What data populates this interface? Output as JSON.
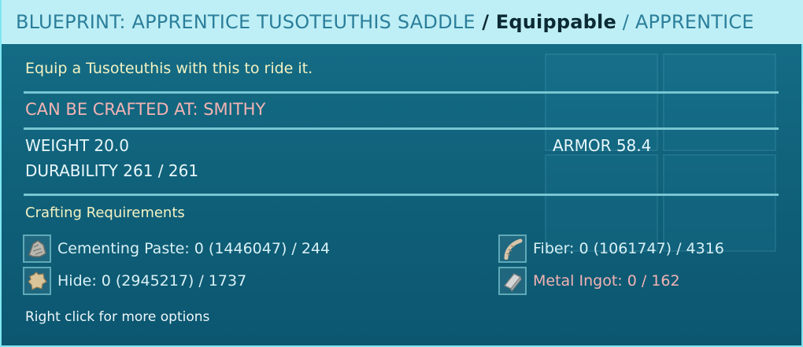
{
  "header": {
    "blueprint_title": "BLUEPRINT: APPRENTICE TUSOTEUTHIS SADDLE",
    "separator1": " / ",
    "item_type": "Equippable",
    "separator2": " / ",
    "quality": "APPRENTICE"
  },
  "description": "Equip a Tusoteuthis with this to ride it.",
  "crafted_at": "CAN BE CRAFTED AT: SMITHY",
  "stats": {
    "weight": "WEIGHT 20.0",
    "durability": "DURABILITY 261 / 261",
    "armor": "ARMOR 58.4"
  },
  "requirements": {
    "title": "Crafting Requirements",
    "items": [
      {
        "label": "Cementing Paste: 0 (1446047) / 244",
        "icon": "cementing-paste-icon"
      },
      {
        "label": "Fiber: 0 (1061747) / 4316",
        "icon": "fiber-icon"
      },
      {
        "label": "Hide: 0 (2945217) / 1737",
        "icon": "hide-icon"
      },
      {
        "label": "Metal Ingot: 0 / 162",
        "icon": "metal-ingot-icon",
        "insufficient": true
      }
    ]
  },
  "hint": "Right click for more options",
  "colors": {
    "header_bg": "#bfeff6",
    "header_text": "#2b7f9b",
    "panel_bg": "#166f88",
    "accent_border": "#7fe6f0",
    "description": "#f3f2c2",
    "warning": "#f3b3b3"
  }
}
